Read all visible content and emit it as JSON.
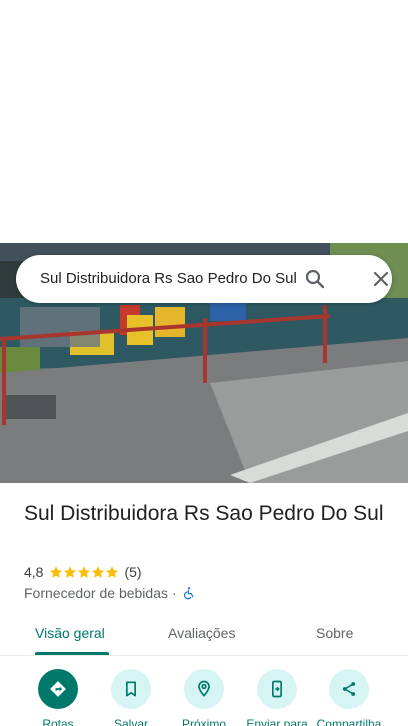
{
  "search": {
    "query": "Sul Distribuidora Rs Sao Pedro Do Sul",
    "search_icon": "search-icon",
    "close_icon": "close-icon"
  },
  "photo": {
    "description_icon": "place-photo"
  },
  "place": {
    "title": "Sul Distribuidora Rs Sao Pedro Do Sul",
    "rating": "4,8",
    "stars": 5,
    "review_count": "(5)",
    "category": "Fornecedor de bebidas",
    "separator": "·",
    "accessibility_icon": "wheelchair-icon"
  },
  "tabs": [
    {
      "label": "Visão geral",
      "active": true
    },
    {
      "label": "Avaliações",
      "active": false
    },
    {
      "label": "Sobre",
      "active": false
    }
  ],
  "actions": [
    {
      "label": "Rotas",
      "icon": "directions-icon"
    },
    {
      "label": "Salvar",
      "icon": "bookmark-icon"
    },
    {
      "label": "Próximo",
      "icon": "nearby-icon"
    },
    {
      "label": "Enviar para",
      "icon": "send-to-phone-icon"
    },
    {
      "label": "Compartilha",
      "icon": "share-icon"
    }
  ],
  "colors": {
    "accent": "#00796b",
    "action_bg": "#d5f4f3",
    "star": "#fbbc04",
    "accessibility": "#1a73e8"
  }
}
